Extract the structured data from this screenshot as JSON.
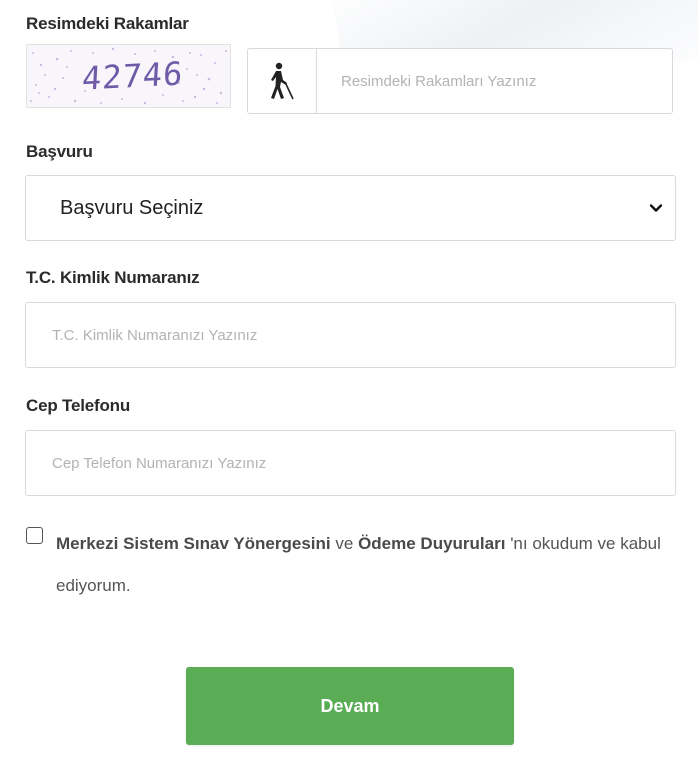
{
  "captcha": {
    "label": "Resimdeki Rakamlar",
    "code": "42746",
    "input_placeholder": "Resimdeki Rakamları Yazınız",
    "audio_icon": "accessibility-blind-icon"
  },
  "application": {
    "label": "Başvuru",
    "selected": "Başvuru Seçiniz"
  },
  "tc_id": {
    "label": "T.C. Kimlik Numaranız",
    "placeholder": "T.C. Kimlik Numaranızı Yazınız"
  },
  "phone": {
    "label": "Cep Telefonu",
    "placeholder": "Cep Telefon Numaranızı Yazınız"
  },
  "consent": {
    "checked": false,
    "link1": "Merkezi Sistem Sınav Yönergesini",
    "between": "ve",
    "link2": "Ödeme Duyuruları",
    "suffix": "'nı okudum ve kabul ediyorum."
  },
  "submit": {
    "label": "Devam",
    "color": "#5aac55"
  }
}
